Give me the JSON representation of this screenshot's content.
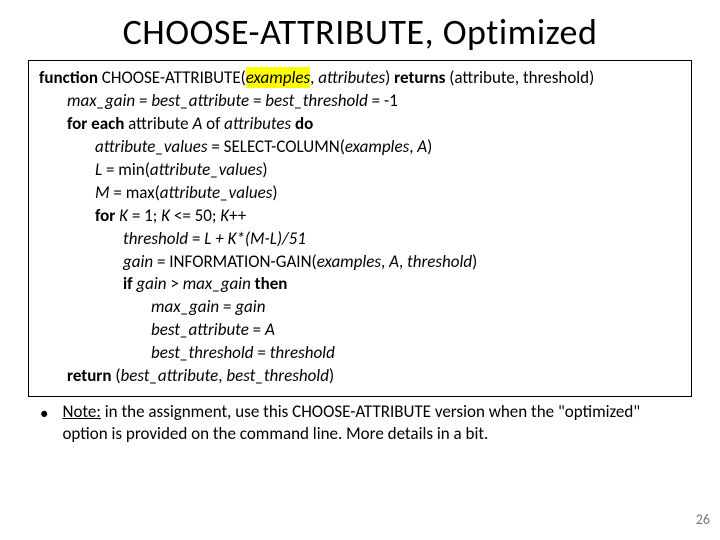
{
  "title": "CHOOSE-ATTRIBUTE, Optimized",
  "bullet": "•",
  "note": {
    "label": "Note:",
    "text": " in the assignment, use this CHOOSE-ATTRIBUTE version when the \"optimized\" option is provided on the command line. More details in a bit."
  },
  "page_number": "26",
  "code": {
    "l1": {
      "kw1": "function",
      "kw2": " CHOOSE-ATTRIBUTE(",
      "hl": "examples",
      "rest1a": ", ",
      "rest1b": "attributes",
      "rest1c": ") ",
      "kw3": "returns",
      "rest2": " (attribute, threshold)"
    },
    "l2": {
      "it1": "max_gain",
      "t1": " = ",
      "it2": "best_attribute",
      "t2": " = ",
      "it3": "best_threshold",
      "t3": " = -1"
    },
    "l3": {
      "kw1": "for each",
      "t1": " attribute ",
      "it1": "A",
      "t2": " of ",
      "it2": "attributes",
      "kw2": " do"
    },
    "l4": {
      "it1": "attribute_values",
      "t1": " = SELECT-COLUMN(",
      "it2": "examples",
      "t2": ", ",
      "it3": "A",
      "t3": ")"
    },
    "l5": {
      "it1": "L",
      "t1": " = min(",
      "it2": "attribute_values",
      "t2": ")"
    },
    "l6": {
      "it1": "M",
      "t1": " = max(",
      "it2": "attribute_values",
      "t2": ")"
    },
    "l7": {
      "kw1": "for",
      "it1": " K",
      "t1": " = 1; ",
      "it2": "K",
      "t2": " <= 50; ",
      "it3": "K",
      "t3": "++"
    },
    "l8": {
      "it1": "threshold",
      "t1": " = ",
      "it2": "L + K*(M-L)/51"
    },
    "l9": {
      "it1": "gain",
      "t1": " = INFORMATION-GAIN(",
      "it2": "examples",
      "t2": ", ",
      "it3": "A",
      "t3": ", ",
      "it4": "threshold",
      "t4": ")"
    },
    "l10": {
      "kw1": "if",
      "it1": " gain",
      "t1": " > ",
      "it2": "max_gain",
      "kw2": " then"
    },
    "l11": {
      "it1": "max_gain",
      "t1": " = ",
      "it2": "gain"
    },
    "l12": {
      "it1": "best_attribute",
      "t1": " = ",
      "it2": "A"
    },
    "l13": {
      "it1": "best_threshold",
      "t1": " = ",
      "it2": "threshold"
    },
    "l14": {
      "kw1": "return",
      "t1": " (",
      "it1": "best_attribute",
      "t2": ", ",
      "it2": "best_threshold",
      "t3": ")"
    }
  }
}
